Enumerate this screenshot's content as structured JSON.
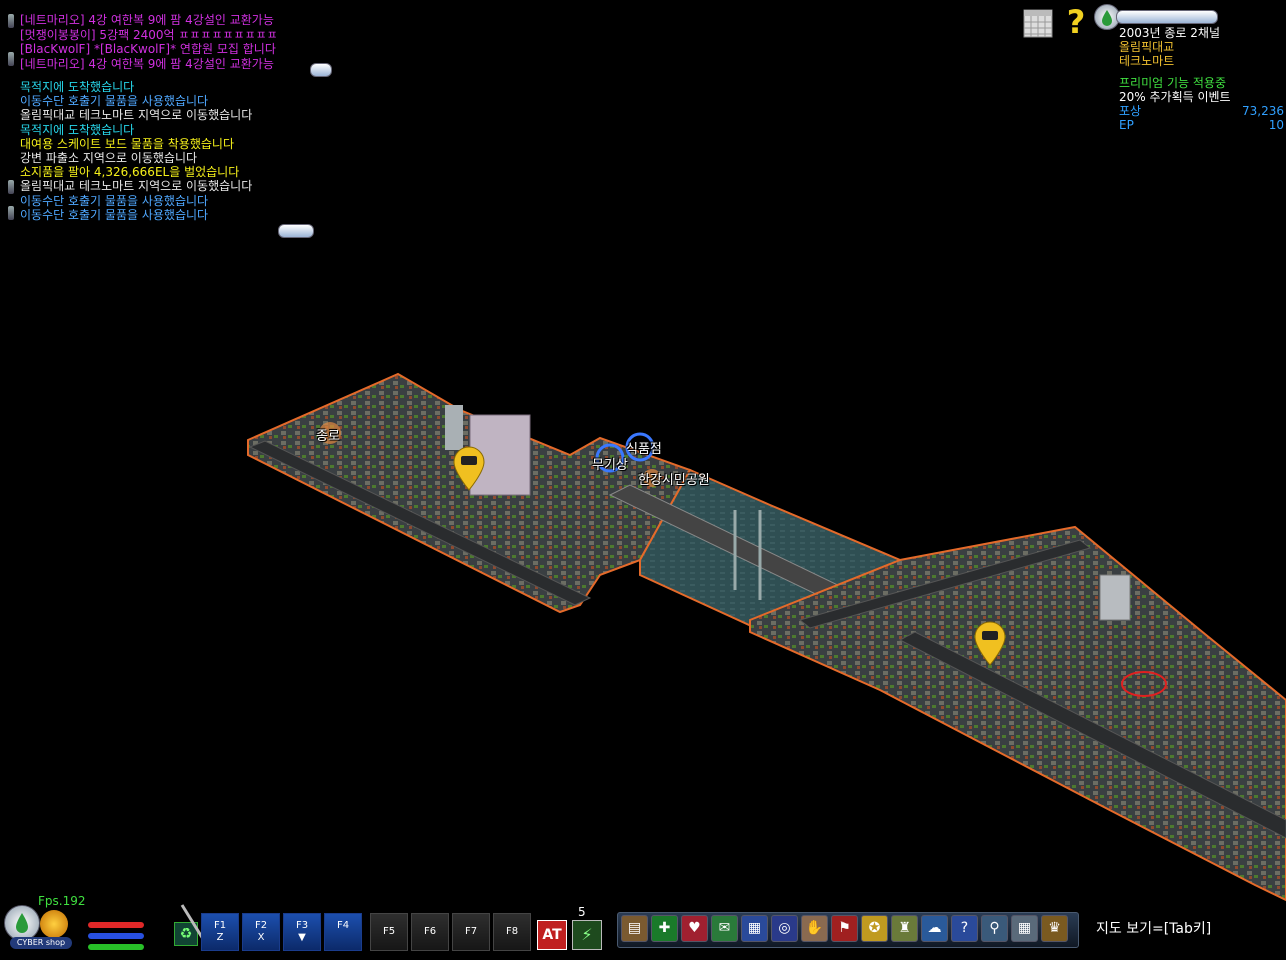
{
  "top_chat": [
    "[네트마리오] 4강 여한복 9에 팜 4강설인 교환가능",
    "[멋쟁이봉봉이] 5강팩 2400억 ㅍㅍㅍㅍㅍㅍㅍㅍㅍ",
    "[BlacKwolF] *[BlacKwolF]* 연합원 모집 합니다",
    "[네트마리오] 4강 여한복 9에 팜 4강설인 교환가능"
  ],
  "system_log": [
    {
      "text": "목적지에 도착했습니다",
      "color": "cyan"
    },
    {
      "text": "이동수단 호출기 물품을 사용했습니다",
      "color": "blue"
    },
    {
      "text": "올림픽대교 테크노마트 지역으로 이동했습니다",
      "color": "white"
    },
    {
      "text": "목적지에 도착했습니다",
      "color": "cyan"
    },
    {
      "text": "대여용 스케이트 보드 물품을 착용했습니다",
      "color": "yellow"
    },
    {
      "text": "강변 파출소 지역으로 이동했습니다",
      "color": "white"
    },
    {
      "text": "소지품을 팔아 4,326,666EL을 벌었습니다",
      "color": "yellow"
    },
    {
      "text": "올림픽대교 테크노마트 지역으로 이동했습니다",
      "color": "white"
    },
    {
      "text": "이동수단 호출기 물품을 사용했습니다",
      "color": "blue"
    },
    {
      "text": "이동수단 호출기 물품을 사용했습니다",
      "color": "blue"
    }
  ],
  "status": {
    "channel": "2003년 종로 2채널",
    "region": "올림픽대교",
    "area": "테크노마트",
    "premium": "프리미엄 기능 적용중",
    "event": "20% 추가획득 이벤트",
    "reward_label": "포상",
    "reward_value": "73,236",
    "ep_label": "EP",
    "ep_value": "10"
  },
  "map": {
    "labels": {
      "jongno": "종로",
      "shop": "식품점",
      "weapon": "무기상",
      "park": "한강시민공원"
    }
  },
  "hud": {
    "fps": "Fps.192",
    "shop_label": "CYBER shop",
    "skill_count": "5",
    "fkeys": [
      {
        "top": "F1",
        "bottom": "Z"
      },
      {
        "top": "F2",
        "bottom": "X"
      },
      {
        "top": "F3",
        "bottom": "▼"
      },
      {
        "top": "F4",
        "bottom": ""
      },
      {
        "top": "F5",
        "bottom": ""
      },
      {
        "top": "F6",
        "bottom": ""
      },
      {
        "top": "F7",
        "bottom": ""
      },
      {
        "top": "F8",
        "bottom": ""
      }
    ],
    "at_label": "AT",
    "map_hint": "지도 보기=[Tab키]"
  },
  "colors": {
    "chat_pink": "#d030e0",
    "log_cyan": "#27d6ea",
    "log_blue": "#4fa8ff",
    "log_yellow": "#f5f01a",
    "status_gold": "#f0c030",
    "status_green": "#40e040",
    "status_blue": "#30a0ff",
    "map_edge": "#e46a2a"
  }
}
